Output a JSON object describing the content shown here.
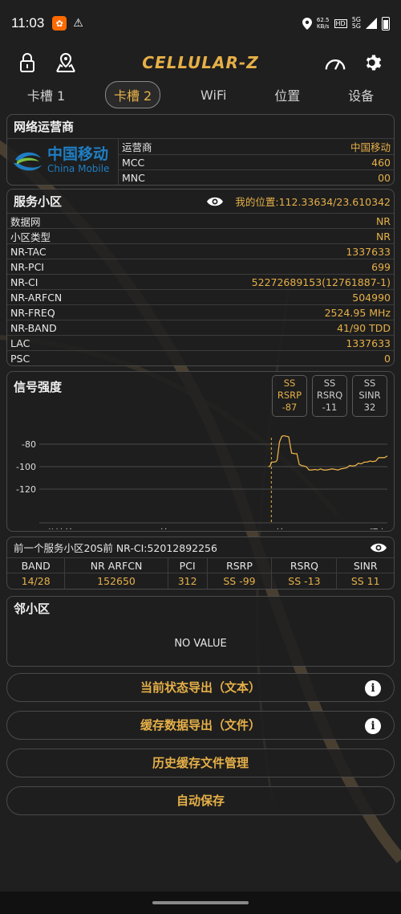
{
  "status_bar": {
    "time": "11:03",
    "speed_value": "62.5",
    "speed_unit": "KB/s",
    "net1": "5G",
    "net2": "5G"
  },
  "toolbar": {
    "app_logo_text": "CELLULAR-Z"
  },
  "tabs": [
    {
      "label": "卡槽 1"
    },
    {
      "label": "卡槽 2"
    },
    {
      "label": "WiFi"
    },
    {
      "label": "位置"
    },
    {
      "label": "设备"
    }
  ],
  "operator": {
    "title": "网络运营商",
    "logo_cn": "中国移动",
    "logo_en": "China Mobile",
    "rows": [
      {
        "k": "运营商",
        "v": "中国移动"
      },
      {
        "k": "MCC",
        "v": "460"
      },
      {
        "k": "MNC",
        "v": "00"
      }
    ]
  },
  "serving": {
    "title": "服务小区",
    "location": "我的位置:112.33634/23.610342",
    "rows": [
      {
        "k": "数据网",
        "v": "NR"
      },
      {
        "k": "小区类型",
        "v": "NR"
      },
      {
        "k": "NR-TAC",
        "v": "1337633"
      },
      {
        "k": "NR-PCI",
        "v": "699"
      },
      {
        "k": "NR-CI",
        "v": "52272689153(12761887-1)"
      },
      {
        "k": "NR-ARFCN",
        "v": "504990"
      },
      {
        "k": "NR-FREQ",
        "v": "2524.95 MHz"
      },
      {
        "k": "NR-BAND",
        "v": "41/90 TDD"
      },
      {
        "k": "LAC",
        "v": "1337633"
      },
      {
        "k": "PSC",
        "v": "0"
      }
    ]
  },
  "signal": {
    "title": "信号强度",
    "metrics": [
      {
        "l1": "SS",
        "l2": "RSRP",
        "v": "-87"
      },
      {
        "l1": "SS",
        "l2": "RSRQ",
        "v": "-11"
      },
      {
        "l1": "SS",
        "l2": "SINR",
        "v": "32"
      }
    ]
  },
  "chart_data": {
    "type": "line",
    "y_ticks": [
      "-80",
      "-100",
      "-120"
    ],
    "ylim": [
      -140,
      -60
    ],
    "x_ticks": [
      "1分钟前",
      "40S前",
      "20S前",
      "现在"
    ],
    "xlim": [
      -60,
      0
    ],
    "series": [
      {
        "x": [
          -20.5,
          -20.2,
          -20,
          -19.6,
          -19.2,
          -19,
          -18.6,
          -18.2,
          -17.8,
          -17.4,
          -17,
          -16.5,
          -16,
          -15.6,
          -15.2,
          -14.8,
          -14.4,
          -14,
          -13.5,
          -13,
          -12.5,
          -12,
          -11.5,
          -11,
          -10.5,
          -10,
          -9.5,
          -9,
          -8.5,
          -8,
          -7.5,
          -7,
          -6.5,
          -6,
          -5.5,
          -5,
          -4.5,
          -4,
          -3.5,
          -3,
          -2.5,
          -2,
          -1.5,
          -1,
          -0.5,
          0
        ],
        "y": [
          -100,
          -99.5,
          -96,
          -96,
          -95.5,
          -94,
          -78,
          -73,
          -72.5,
          -73,
          -73.5,
          -88,
          -88.5,
          -88.5,
          -98,
          -99,
          -99.5,
          -100,
          -103,
          -103,
          -102.5,
          -103,
          -102,
          -103,
          -103,
          -102.5,
          -102,
          -102.5,
          -103,
          -102,
          -101.5,
          -101,
          -99,
          -99.5,
          -99,
          -97,
          -97.5,
          -96,
          -96,
          -95,
          -95.5,
          -95,
          -92,
          -92,
          -92,
          -90.5
        ]
      }
    ],
    "marker_x": -20
  },
  "prev_cell": {
    "title": "前一个服务小区20S前 NR-CI:52012892256",
    "headers": [
      "BAND",
      "NR ARFCN",
      "PCI",
      "RSRP",
      "RSRQ",
      "SINR"
    ],
    "values": [
      "14/28",
      "152650",
      "312",
      "SS -99",
      "SS -13",
      "SS 11"
    ]
  },
  "neighbor": {
    "title": "邻小区",
    "empty": "NO VALUE"
  },
  "actions": [
    {
      "label": "当前状态导出（文本）",
      "info": true
    },
    {
      "label": "缓存数据导出（文件）",
      "info": true
    },
    {
      "label": "历史缓存文件管理",
      "info": false
    },
    {
      "label": "自动保存",
      "info": false
    }
  ],
  "colors": {
    "accent": "#e6b048",
    "bg": "#1f1f1f",
    "border": "#4a4a4a"
  }
}
